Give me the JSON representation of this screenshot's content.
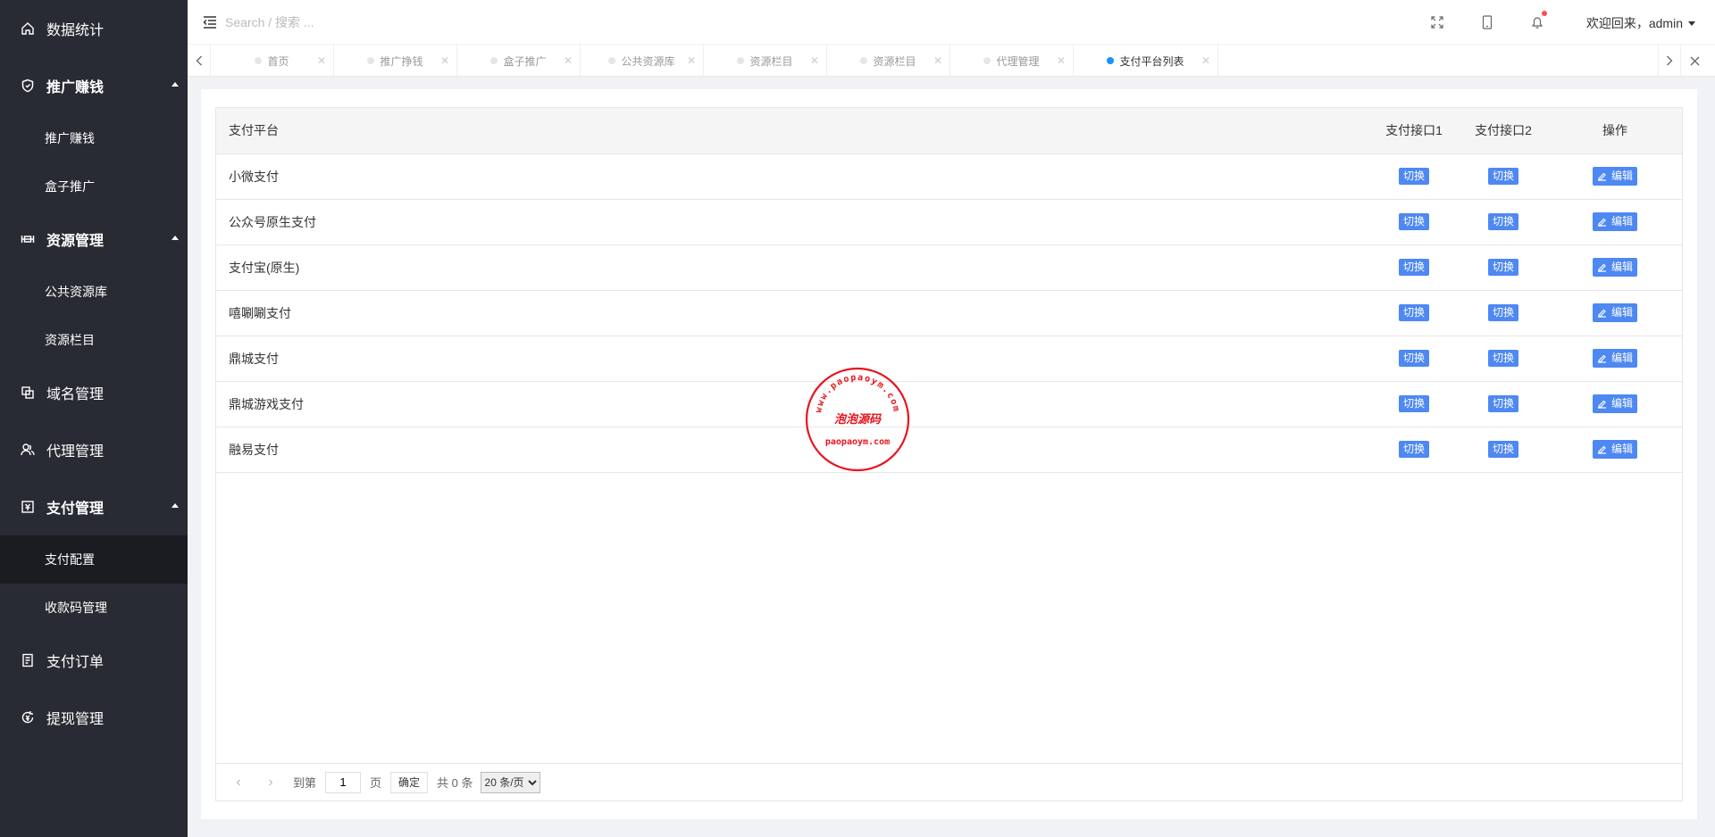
{
  "sidebar": {
    "items": [
      {
        "label": "数据统计",
        "icon": "home-icon"
      },
      {
        "label": "推广赚钱",
        "icon": "shield-icon",
        "expanded": true,
        "children": [
          "推广赚钱",
          "盒子推广"
        ]
      },
      {
        "label": "资源管理",
        "icon": "resource-icon",
        "expanded": true,
        "children": [
          "公共资源库",
          "资源栏目"
        ]
      },
      {
        "label": "域名管理",
        "icon": "copy-icon"
      },
      {
        "label": "代理管理",
        "icon": "users-icon"
      },
      {
        "label": "支付管理",
        "icon": "pay-icon",
        "expanded": true,
        "children": [
          "支付配置",
          "收款码管理"
        ]
      },
      {
        "label": "支付订单",
        "icon": "order-icon"
      },
      {
        "label": "提现管理",
        "icon": "withdraw-icon"
      }
    ],
    "active_child": "支付配置"
  },
  "header": {
    "search_placeholder": "Search / 搜索 ...",
    "user_label": "欢迎回来，admin",
    "icons": [
      "menu-toggle-icon",
      "fullscreen-icon",
      "mobile-icon",
      "bell-icon"
    ],
    "bell_badge_color": "#ff4d4f"
  },
  "tabs": [
    {
      "label": "首页",
      "active": false
    },
    {
      "label": "推广挣钱",
      "active": false
    },
    {
      "label": "盒子推广",
      "active": false
    },
    {
      "label": "公共资源库",
      "active": false
    },
    {
      "label": "资源栏目",
      "active": false
    },
    {
      "label": "资源栏目",
      "active": false
    },
    {
      "label": "代理管理",
      "active": false
    },
    {
      "label": "支付平台列表",
      "active": true
    }
  ],
  "table": {
    "headers": [
      "支付平台",
      "支付接口1",
      "支付接口2",
      "操作"
    ],
    "switch_label": "切换",
    "edit_label": "编辑",
    "rows": [
      "小微支付",
      "公众号原生支付",
      "支付宝(原生)",
      "嘻唰唰支付",
      "鼎城支付",
      "鼎城游戏支付",
      "融易支付"
    ]
  },
  "pager": {
    "goto_label": "到第",
    "page_value": "1",
    "page_unit": "页",
    "confirm_label": "确定",
    "total_label": "共 0 条",
    "page_size": "20 条/页"
  },
  "stamp": {
    "outer_text": "www.paopaoym.com",
    "center_text": "泡泡源码",
    "bottom_text": "paopaoym.com"
  },
  "colors": {
    "sidebar_bg": "#282b33",
    "sidebar_active": "#1a1c21",
    "accent": "#4e88f2",
    "active_tab_dot": "#1890ff",
    "stamp": "#e8141c"
  }
}
